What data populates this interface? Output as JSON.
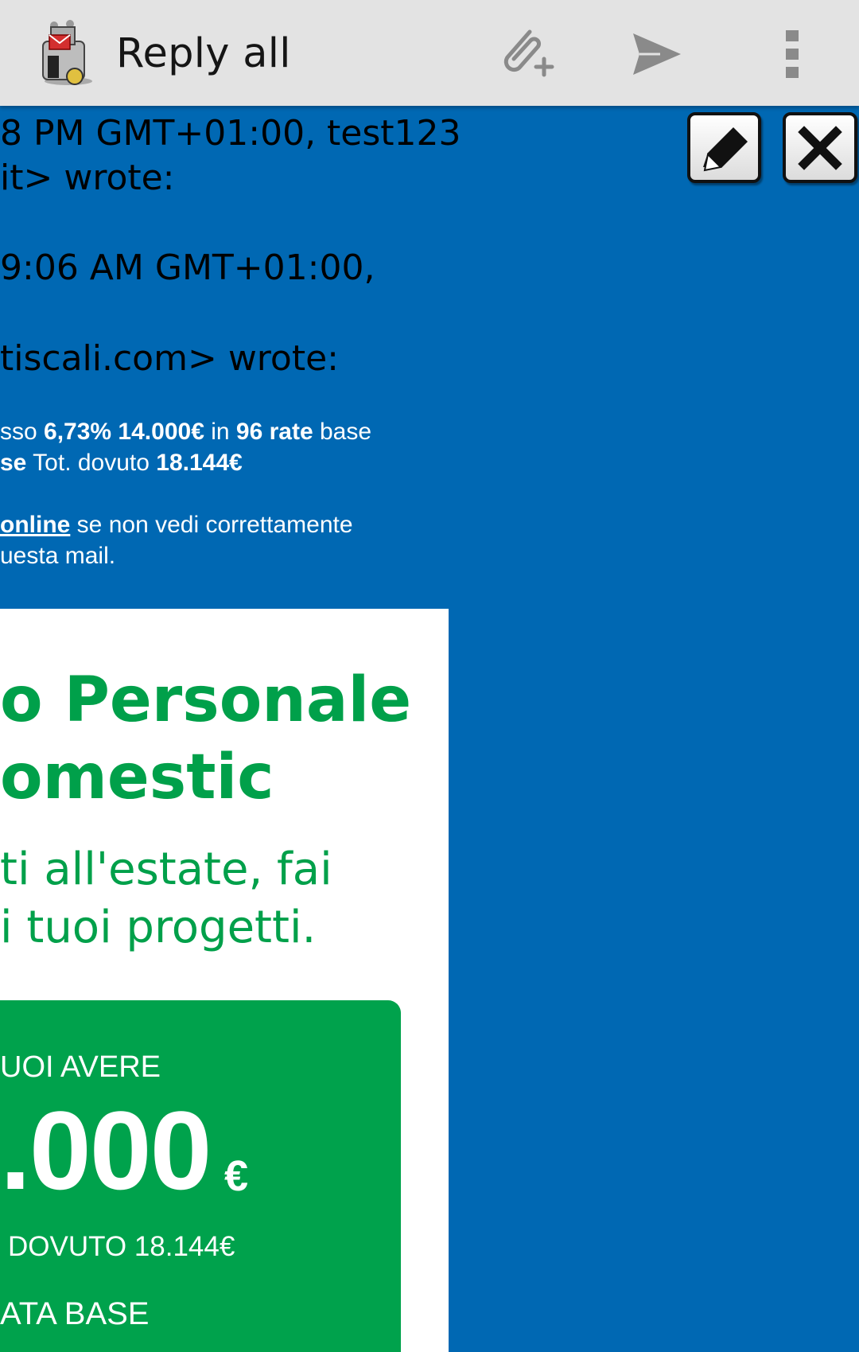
{
  "app_bar": {
    "title": "Reply all",
    "icons": {
      "app": "app-icon",
      "attach": "attach-add-icon",
      "send": "send-icon",
      "more": "more-vert-icon"
    }
  },
  "quoted": {
    "line1": "8 PM GMT+01:00, test123",
    "line2": "it> wrote:",
    "line3": "9:06 AM GMT+01:00,",
    "line4": "tiscali.com> wrote:",
    "promo": {
      "l1_a": "sso ",
      "l1_b": "6,73% 14.000€",
      "l1_c": " in ",
      "l1_d": "96 rate",
      "l1_e": " base",
      "l2_a": "se",
      "l2_b": " Tot. dovuto ",
      "l2_c": "18.144€",
      "l3_link": "online",
      "l3_rest": " se non vedi correttamente",
      "l4": "uesta mail."
    }
  },
  "tools": {
    "edit": "pencil-icon",
    "close": "close-icon"
  },
  "card": {
    "headline_1": "o Personale",
    "headline_2": "omestic",
    "sub_1": "ti all'estate, fai",
    "sub_2": "i tuoi progetti.",
    "box": {
      "label": "UOI AVERE",
      "amount": ".000",
      "currency": "€",
      "total": "DOVUTO 18.144€",
      "rate": "ATA BASE"
    }
  },
  "colors": {
    "background": "#0068b3",
    "appbar": "#e3e3e3",
    "green": "#00a04a",
    "box_green": "#00a24c"
  }
}
